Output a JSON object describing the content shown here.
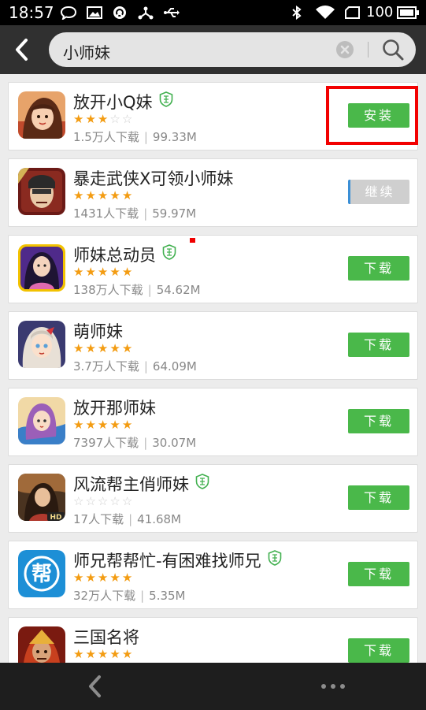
{
  "status_bar": {
    "time": "18:57",
    "battery": "100"
  },
  "search": {
    "query": "小师妹"
  },
  "apps": [
    {
      "name": "放开小Q妹",
      "verified": true,
      "rating": 3,
      "downloads": "1.5万人下载",
      "size": "99.33M",
      "button": "安装",
      "button_style": "green"
    },
    {
      "name": "暴走武侠X可领小师妹",
      "verified": false,
      "rating": 4.5,
      "downloads": "1431人下载",
      "size": "59.97M",
      "button": "继续",
      "button_style": "gray"
    },
    {
      "name": "师妹总动员",
      "verified": true,
      "rating": 5,
      "downloads": "138万人下载",
      "size": "54.62M",
      "button": "下载",
      "button_style": "green"
    },
    {
      "name": "萌师妹",
      "verified": false,
      "rating": 5,
      "downloads": "3.7万人下载",
      "size": "64.09M",
      "button": "下载",
      "button_style": "green"
    },
    {
      "name": "放开那师妹",
      "verified": false,
      "rating": 5,
      "downloads": "7397人下载",
      "size": "30.07M",
      "button": "下载",
      "button_style": "green"
    },
    {
      "name": "风流帮主俏师妹",
      "verified": true,
      "rating": 0,
      "downloads": "17人下载",
      "size": "41.68M",
      "button": "下载",
      "button_style": "green"
    },
    {
      "name": "师兄帮帮忙-有困难找师兄",
      "verified": true,
      "rating": 4.5,
      "downloads": "32万人下载",
      "size": "5.35M",
      "button": "下载",
      "button_style": "green"
    },
    {
      "name": "三国名将",
      "verified": false,
      "rating": 5,
      "downloads": "",
      "size": "",
      "button": "下载",
      "button_style": "green"
    }
  ],
  "icons": [
    "app-icon-fangkai-xiaoqmei",
    "app-icon-baozou-wuxia",
    "app-icon-shimei-zongdongyuan",
    "app-icon-meng-shimei",
    "app-icon-fangkai-na-shimei",
    "app-icon-fengliu-bangzhu",
    "app-icon-bang-text",
    "app-icon-sanguo-mingjiang"
  ],
  "icon_text": {
    "bang": "帮",
    "hd": "HD"
  },
  "colors": {
    "accent_green": "#4ab84a",
    "highlight_red": "#f20000",
    "star": "#f39c12"
  }
}
